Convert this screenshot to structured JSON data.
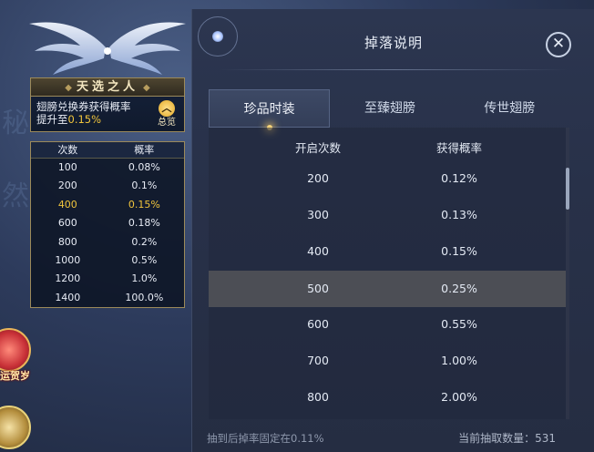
{
  "left_card": {
    "title": "天选之人",
    "line1": "翅膀兑换券获得概率",
    "line2_prefix": "提升至",
    "line2_value": "0.15%",
    "summary_icon": "chevron-up-icon",
    "summary_label": "总览"
  },
  "left_table": {
    "headers": [
      "次数",
      "概率"
    ],
    "rows": [
      {
        "count": "100",
        "rate": "0.08%"
      },
      {
        "count": "200",
        "rate": "0.1%"
      },
      {
        "count": "400",
        "rate": "0.15%",
        "highlight": true
      },
      {
        "count": "600",
        "rate": "0.18%"
      },
      {
        "count": "800",
        "rate": "0.2%"
      },
      {
        "count": "1000",
        "rate": "0.5%"
      },
      {
        "count": "1200",
        "rate": "1.0%"
      },
      {
        "count": "1400",
        "rate": "100.0%"
      }
    ]
  },
  "side_buttons": [
    {
      "label": "运贺岁",
      "icon": "festival-icon"
    },
    {
      "label": "",
      "icon": "coin-icon"
    }
  ],
  "panel": {
    "title": "掉落说明",
    "close_icon": "close-icon",
    "tabs": [
      {
        "label": "珍品时装",
        "active": true
      },
      {
        "label": "至臻翅膀",
        "active": false
      },
      {
        "label": "传世翅膀",
        "active": false
      }
    ],
    "columns": [
      "开启次数",
      "获得概率"
    ],
    "rows": [
      {
        "count": "200",
        "rate": "0.12%"
      },
      {
        "count": "300",
        "rate": "0.13%"
      },
      {
        "count": "400",
        "rate": "0.15%"
      },
      {
        "count": "500",
        "rate": "0.25%",
        "highlight": true
      },
      {
        "count": "600",
        "rate": "0.55%"
      },
      {
        "count": "700",
        "rate": "1.00%"
      },
      {
        "count": "800",
        "rate": "2.00%"
      }
    ],
    "footer_left": "抽到后掉率固定在0.11%",
    "footer_right_label": "当前抽取数量：",
    "footer_right_value": "531"
  },
  "colors": {
    "accent_gold": "#f0c43c",
    "panel_bg": "#283149",
    "highlight_row": "#4c4e55"
  }
}
